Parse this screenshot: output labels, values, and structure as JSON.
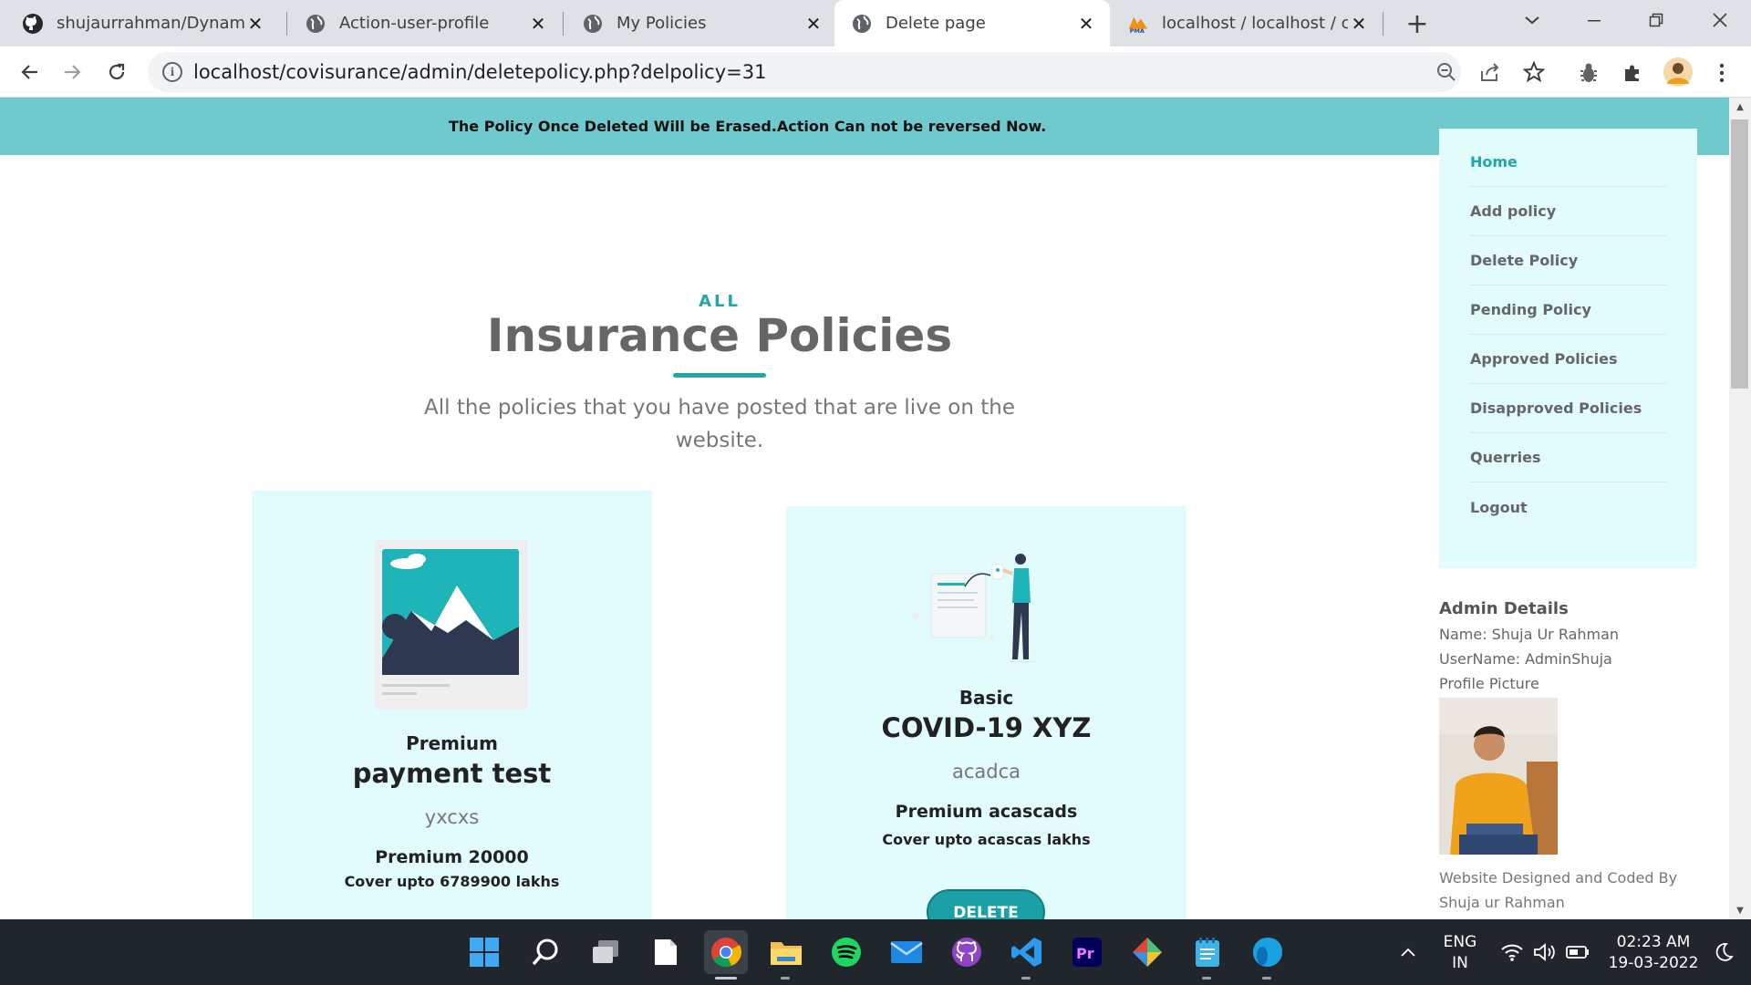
{
  "browser": {
    "tabs": [
      {
        "title": "shujaurrahman/Dynamic-I",
        "icon": "github-icon",
        "active": false
      },
      {
        "title": "Action-user-profile",
        "icon": "globe-icon",
        "active": false
      },
      {
        "title": "My Policies",
        "icon": "globe-icon",
        "active": false
      },
      {
        "title": "Delete page",
        "icon": "globe-icon",
        "active": true
      },
      {
        "title": "localhost / localhost / cov",
        "icon": "phpmyadmin-icon",
        "active": false
      }
    ],
    "url": "localhost/covisurance/admin/deletepolicy.php?delpolicy=31",
    "info_symbol": "i"
  },
  "page": {
    "alert": "The Policy Once Deleted Will be Erased.Action Can not be reversed Now.",
    "section_label": "ALL",
    "section_title": "Insurance Policies",
    "section_subtitle": "All the policies that you have posted that are live on the website.",
    "policies": [
      {
        "tier": "Premium",
        "name": "payment test",
        "description": "yxcxs",
        "premium": "Premium 20000",
        "cover": "Cover upto 6789900 lakhs",
        "action": ""
      },
      {
        "tier": "Basic",
        "name": "COVID-19 XYZ",
        "description": "acadca",
        "premium": "Premium acascads",
        "cover": "Cover upto acascas lakhs",
        "action": "DELETE"
      }
    ],
    "sidebar": {
      "items": [
        "Home",
        "Add policy",
        "Delete Policy",
        "Pending Policy",
        "Approved Policies",
        "Disapproved Policies",
        "Querries",
        "Logout"
      ]
    },
    "admin": {
      "heading": "Admin Details",
      "name": "Name: Shuja Ur Rahman",
      "username": "UserName: AdminShuja",
      "picture_label": "Profile Picture"
    },
    "footer": "Website Designed and Coded By Shuja ur Rahman"
  },
  "taskbar": {
    "lang_top": "ENG",
    "lang_bottom": "IN",
    "time": "02:23 AM",
    "date": "19-03-2022"
  },
  "colors": {
    "accent": "#21a6a9",
    "alert_bg": "#70c9cc",
    "card_bg": "#e2fbfb"
  }
}
